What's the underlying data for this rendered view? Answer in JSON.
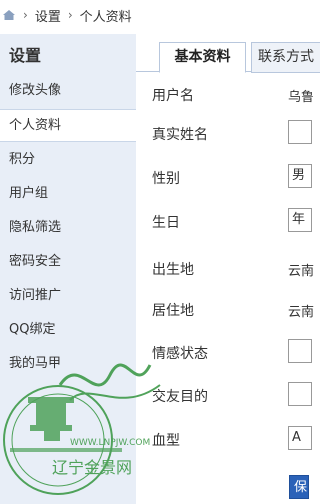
{
  "breadcrumb": {
    "home_icon": "home-icon",
    "separator": "›",
    "items": [
      "设置",
      "个人资料"
    ]
  },
  "sidebar": {
    "title": "设置",
    "items": [
      {
        "label": "修改头像"
      },
      {
        "label": "个人资料"
      },
      {
        "label": "积分"
      },
      {
        "label": "用户组"
      },
      {
        "label": "隐私筛选"
      },
      {
        "label": "密码安全"
      },
      {
        "label": "访问推广"
      },
      {
        "label": "QQ绑定"
      },
      {
        "label": "我的马甲"
      }
    ],
    "active_index": 1
  },
  "tabs": [
    {
      "label": "基本资料",
      "active": true
    },
    {
      "label": "联系方式",
      "active": false
    }
  ],
  "form": {
    "username_label": "用户名",
    "username_value": "乌鲁",
    "realname_label": "真实姓名",
    "gender_label": "性别",
    "gender_value": "男",
    "birthday_label": "生日",
    "birthday_value": "年",
    "birthplace_label": "出生地",
    "birthplace_value": "云南",
    "residence_label": "居住地",
    "residence_value": "云南",
    "marital_label": "情感状态",
    "purpose_label": "交友目的",
    "blood_label": "血型",
    "blood_value": "A",
    "save_label": "保存"
  },
  "watermark": {
    "url": "WWW.LNPJW.COM",
    "cn_text": "辽宁金景网",
    "mark": "sign"
  },
  "colors": {
    "sidebar_bg": "#e8eef7",
    "tab_border": "#b8c7dd",
    "button_bg": "#2b62b8",
    "watermark_green": "#3f9a4a"
  }
}
